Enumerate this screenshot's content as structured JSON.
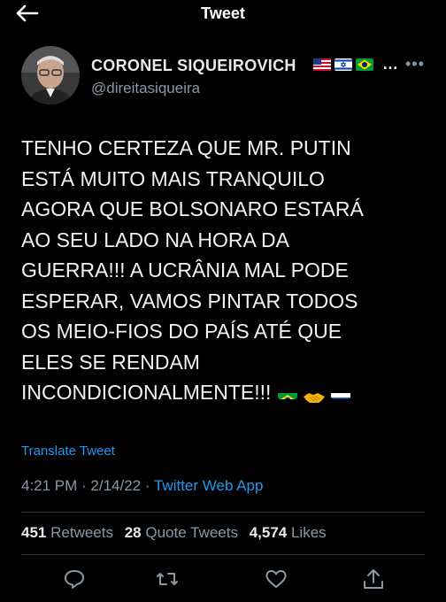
{
  "header": {
    "title": "Tweet",
    "back_icon": "arrow-left-icon"
  },
  "author": {
    "name": "CORONEL SIQUEIROVICH",
    "name_suffix": "…",
    "handle": "@direitasiqueira",
    "flags": [
      "us-flag-icon",
      "israel-flag-icon",
      "brazil-flag-icon"
    ],
    "more_label": "•••"
  },
  "tweet": {
    "lines": [
      "TENHO CERTEZA QUE MR. PUTIN",
      "ESTÁ MUITO MAIS TRANQUILO",
      "AGORA QUE BOLSONARO ESTARÁ",
      "AO SEU LADO NA HORA DA",
      "GUERRA!!! A UCRÂNIA MAL PODE",
      "ESPERAR, VAMOS PINTAR TODOS",
      "OS MEIO-FIOS DO PAÍS ATÉ QUE",
      "ELES SE RENDAM",
      "INCONDICIONALMENTE!!!"
    ],
    "trailing_emoji": [
      "brazil-flag-icon",
      "handshake-icon",
      "russia-flag-icon"
    ]
  },
  "translate_label": "Translate Tweet",
  "meta": {
    "time": "4:21 PM",
    "separator": " · ",
    "date": "2/14/22",
    "app": "Twitter Web App"
  },
  "stats": {
    "retweets_count": "451",
    "retweets_label": "Retweets",
    "quotes_count": "28",
    "quotes_label": "Quote Tweets",
    "likes_count": "4,574",
    "likes_label": "Likes"
  },
  "actions": [
    "reply-icon",
    "retweet-icon",
    "like-icon",
    "share-icon"
  ],
  "colors": {
    "background": "#000000",
    "text": "#e7e9ea",
    "muted": "#8b98a5",
    "link": "#1d9bf0",
    "divider": "#2f3336"
  }
}
